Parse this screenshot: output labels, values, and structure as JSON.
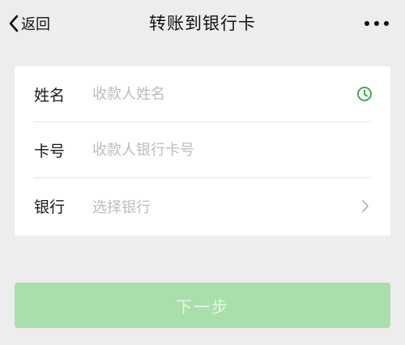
{
  "nav": {
    "back_label": "返回",
    "title": "转账到银行卡"
  },
  "form": {
    "name": {
      "label": "姓名",
      "placeholder": "收款人姓名",
      "icon": "clock-icon"
    },
    "card": {
      "label": "卡号",
      "placeholder": "收款人银行卡号"
    },
    "bank": {
      "label": "银行",
      "placeholder": "选择银行",
      "icon": "chevron-right-icon"
    }
  },
  "next_button": {
    "label": "下一步",
    "color": "#a8dfab",
    "enabled": false
  },
  "colors": {
    "background": "#ededed",
    "accent": "#07c160"
  }
}
